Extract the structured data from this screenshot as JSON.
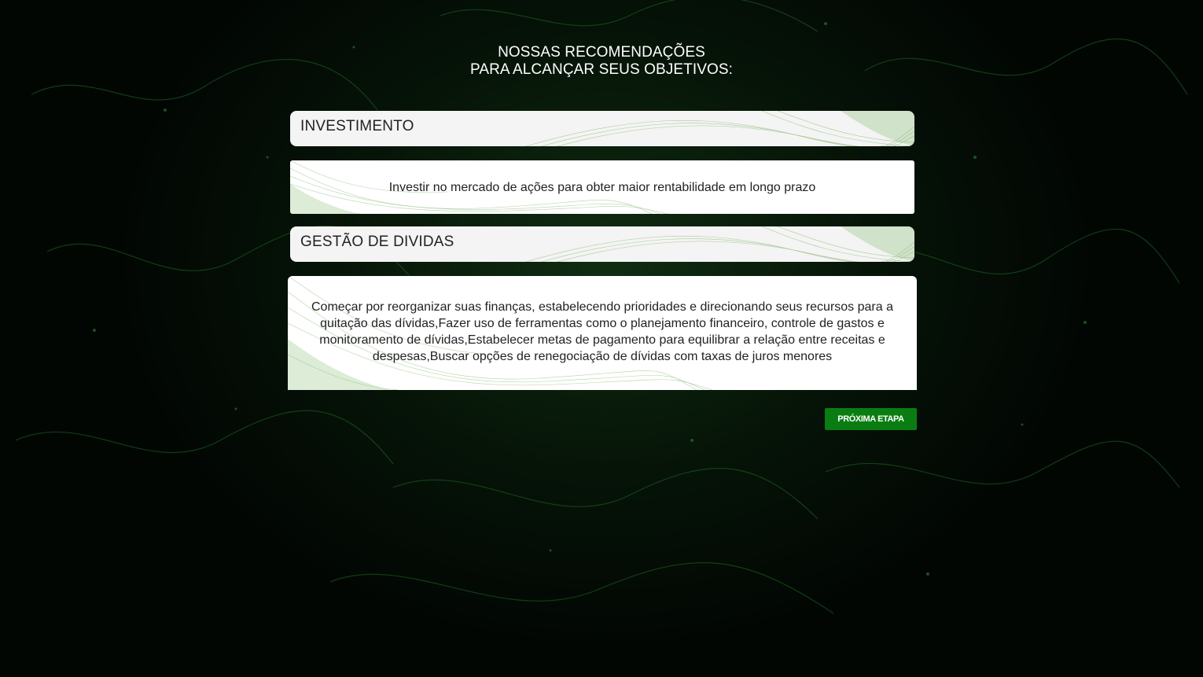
{
  "page": {
    "title_line1": "NOSSAS RECOMENDAÇÕES",
    "title_line2": "PARA ALCANÇAR SEUS OBJETIVOS:"
  },
  "recommendations": [
    {
      "heading": "INVESTIMENTO",
      "text": "Investir no mercado de ações para obter maior rentabilidade em longo prazo"
    },
    {
      "heading": "GESTÃO DE DIVIDAS",
      "text": "Começar por reorganizar suas finanças, estabelecendo prioridades e direcionando seus recursos para a quitação das dívidas,Fazer uso de ferramentas como o planejamento financeiro, controle de gastos e monitoramento de dívidas,Estabelecer metas de pagamento para equilibrar a relação entre receitas e despesas,Buscar opções de renegociação de dívidas com taxas de juros menores"
    }
  ],
  "actions": {
    "next_label": "PRÓXIMA ETAPA"
  },
  "colors": {
    "background": "#020603",
    "accent_green": "#0a7d12",
    "card_background": "#ffffff",
    "heading_background": "#f4f4f4",
    "wave_green": "#5a9c3c"
  }
}
